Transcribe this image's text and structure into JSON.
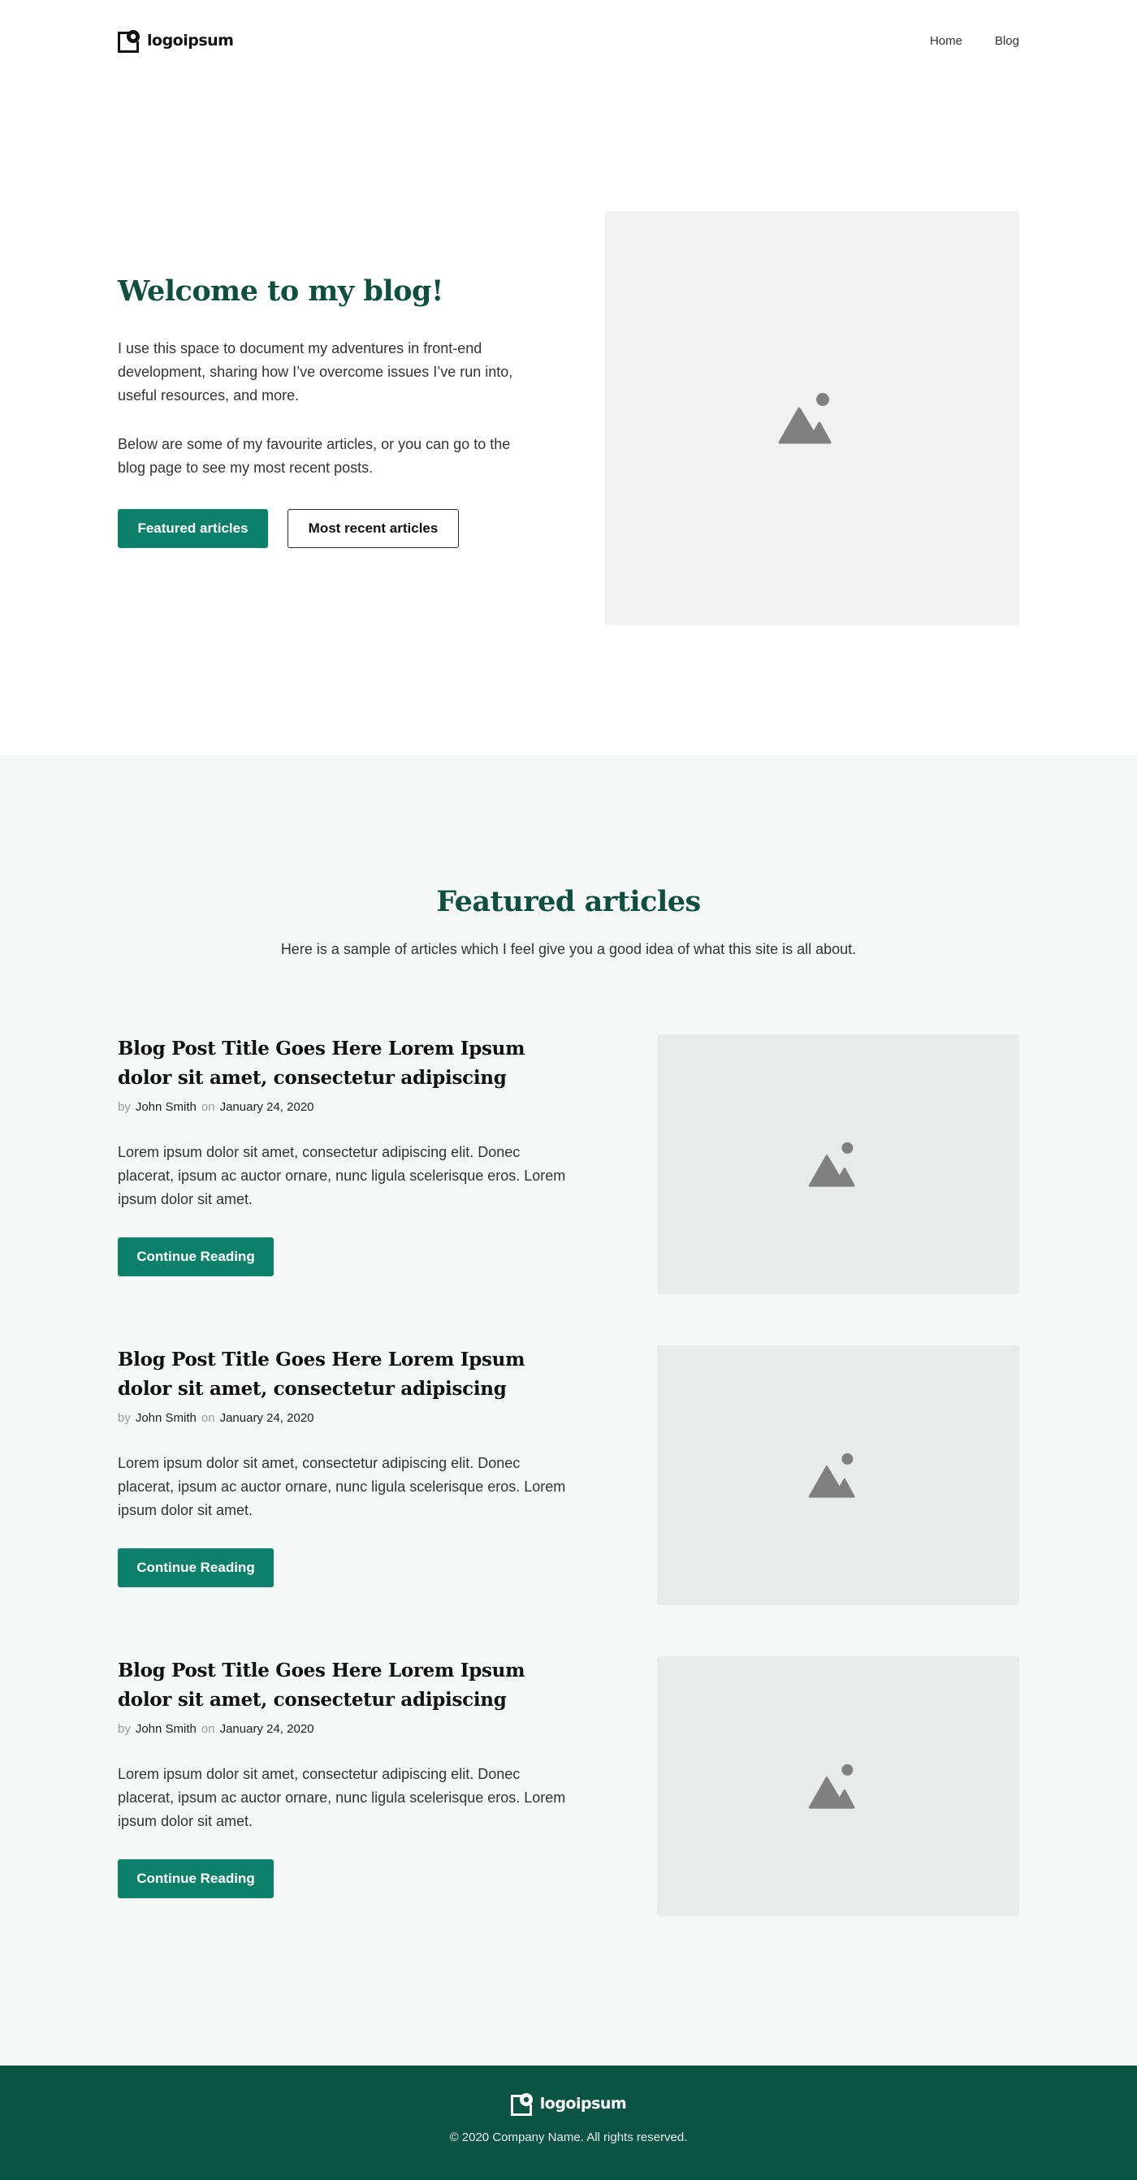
{
  "header": {
    "logo_text": "logoipsum",
    "nav": [
      {
        "label": "Home"
      },
      {
        "label": "Blog"
      }
    ]
  },
  "hero": {
    "title": "Welcome to my blog!",
    "paragraphs": [
      "I use this space to document my adventures in front-end development, sharing how I’ve overcome issues I’ve run into, useful resources, and more.",
      "Below are some of my favourite articles, or you can go to the blog page to see my most recent posts."
    ],
    "primary_button": "Featured articles",
    "secondary_button": "Most recent articles",
    "image_icon": "image-placeholder-icon"
  },
  "featured": {
    "title": "Featured articles",
    "subtitle": "Here is a sample of articles which I feel give you a good idea of what this site is all about.",
    "articles": [
      {
        "title": "Blog Post Title Goes Here Lorem Ipsum dolor sit amet, consectetur adipiscing",
        "by_label": "by",
        "author": "John Smith",
        "on_label": "on",
        "date": "January 24, 2020",
        "excerpt": "Lorem ipsum dolor sit amet, consectetur adipiscing elit. Donec placerat, ipsum ac auctor ornare, nunc ligula scelerisque eros. Lorem ipsum dolor sit amet.",
        "button": "Continue Reading"
      },
      {
        "title": "Blog Post Title Goes Here Lorem Ipsum dolor sit amet, consectetur adipiscing",
        "by_label": "by",
        "author": "John Smith",
        "on_label": "on",
        "date": "January 24, 2020",
        "excerpt": "Lorem ipsum dolor sit amet, consectetur adipiscing elit. Donec placerat, ipsum ac auctor ornare, nunc ligula scelerisque eros. Lorem ipsum dolor sit amet.",
        "button": "Continue Reading"
      },
      {
        "title": "Blog Post Title Goes Here Lorem Ipsum dolor sit amet, consectetur adipiscing",
        "by_label": "by",
        "author": "John Smith",
        "on_label": "on",
        "date": "January 24, 2020",
        "excerpt": "Lorem ipsum dolor sit amet, consectetur adipiscing elit. Donec placerat, ipsum ac auctor ornare, nunc ligula scelerisque eros. Lorem ipsum dolor sit amet.",
        "button": "Continue Reading"
      }
    ]
  },
  "footer": {
    "logo_text": "logoipsum",
    "copyright": "© 2020 Company Name. All rights reserved."
  },
  "colors": {
    "accent": "#0d806b",
    "heading": "#0f4f3f",
    "footer_bg": "#0b5444",
    "section_bg": "#f6f8f7"
  }
}
